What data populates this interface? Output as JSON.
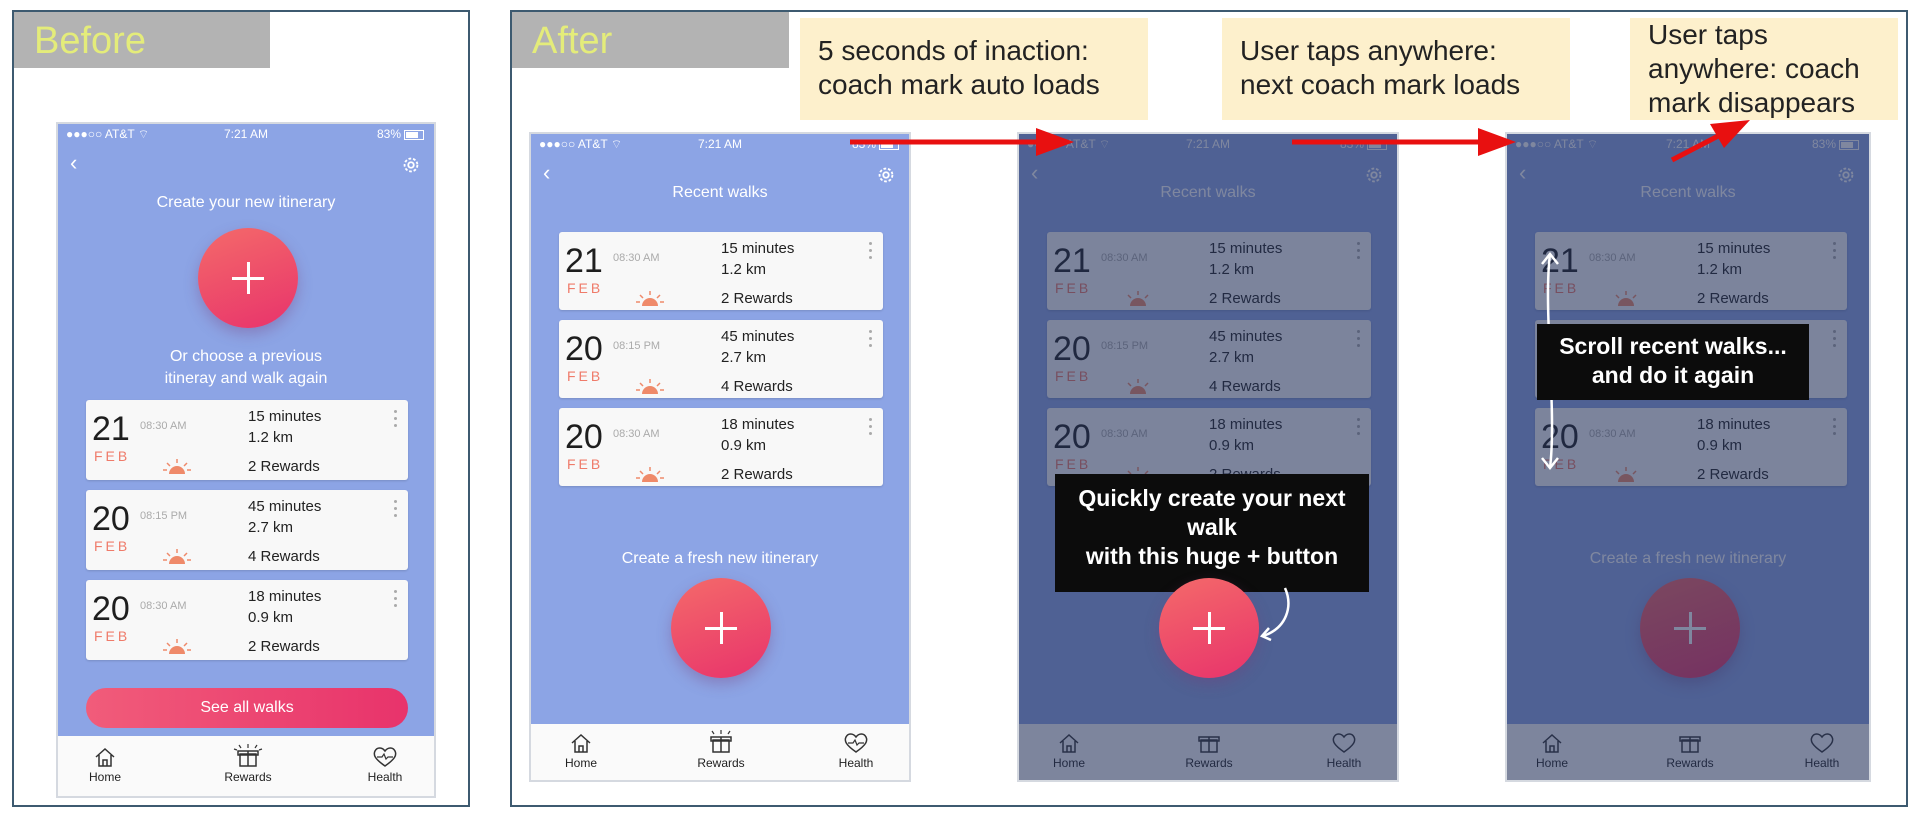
{
  "labels": {
    "before": "Before",
    "after": "After"
  },
  "status": {
    "carrier": "AT&T",
    "time": "7:21 AM",
    "battery": "83%"
  },
  "before_screen": {
    "title": "Create your new itinerary",
    "subtitle_line1": "Or choose a previous",
    "subtitle_line2": "itineray and walk again",
    "see_all": "See all walks"
  },
  "after_screen": {
    "title": "Recent walks",
    "create_label": "Create a fresh new itinerary"
  },
  "walks": [
    {
      "day": "21",
      "month": "FEB",
      "time": "08:30 AM",
      "duration": "15 minutes",
      "distance": "1.2 km",
      "rewards": "2 Rewards"
    },
    {
      "day": "20",
      "month": "FEB",
      "time": "08:15 PM",
      "duration": "45 minutes",
      "distance": "2.7 km",
      "rewards": "4 Rewards"
    },
    {
      "day": "20",
      "month": "FEB",
      "time": "08:30 AM",
      "duration": "18 minutes",
      "distance": "0.9 km",
      "rewards": "2 Rewards"
    }
  ],
  "tabs": {
    "home": "Home",
    "rewards": "Rewards",
    "health": "Health"
  },
  "callouts": {
    "c1_line1": "5 seconds of inaction:",
    "c1_line2": "coach mark auto loads",
    "c2_line1": "User taps anywhere:",
    "c2_line2": "next coach mark loads",
    "c3_line1": "User taps",
    "c3_line2": "anywhere: coach",
    "c3_line3": "mark disappears"
  },
  "coach_marks": {
    "create_line1": "Quickly create your next",
    "create_line2": "walk",
    "create_line3": "with this huge + button",
    "scroll_line1": "Scroll recent walks...",
    "scroll_line2": "and do it again"
  },
  "colors": {
    "accent": "#e8336b",
    "phone_bg": "#8ca4e5",
    "callout_bg": "#fdf0cc",
    "arrow": "#e81010"
  }
}
